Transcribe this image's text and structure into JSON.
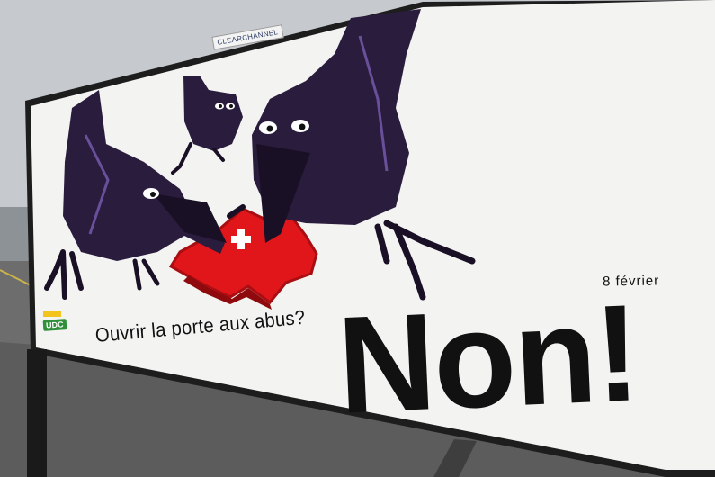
{
  "billboard": {
    "sponsor_label": "CLEARCHANNEL",
    "date": "8 février",
    "question": "Ouvrir la porte aux abus?",
    "answer": "Non!",
    "party_logo": "UDC"
  },
  "colors": {
    "sky": "#c9ccd1",
    "poster": "#f4f4f4",
    "crow": "#2a1c3d",
    "crow_highlight": "#6a4f9a",
    "switzerland": "#e0161b",
    "ground": "#6f6f6f"
  }
}
